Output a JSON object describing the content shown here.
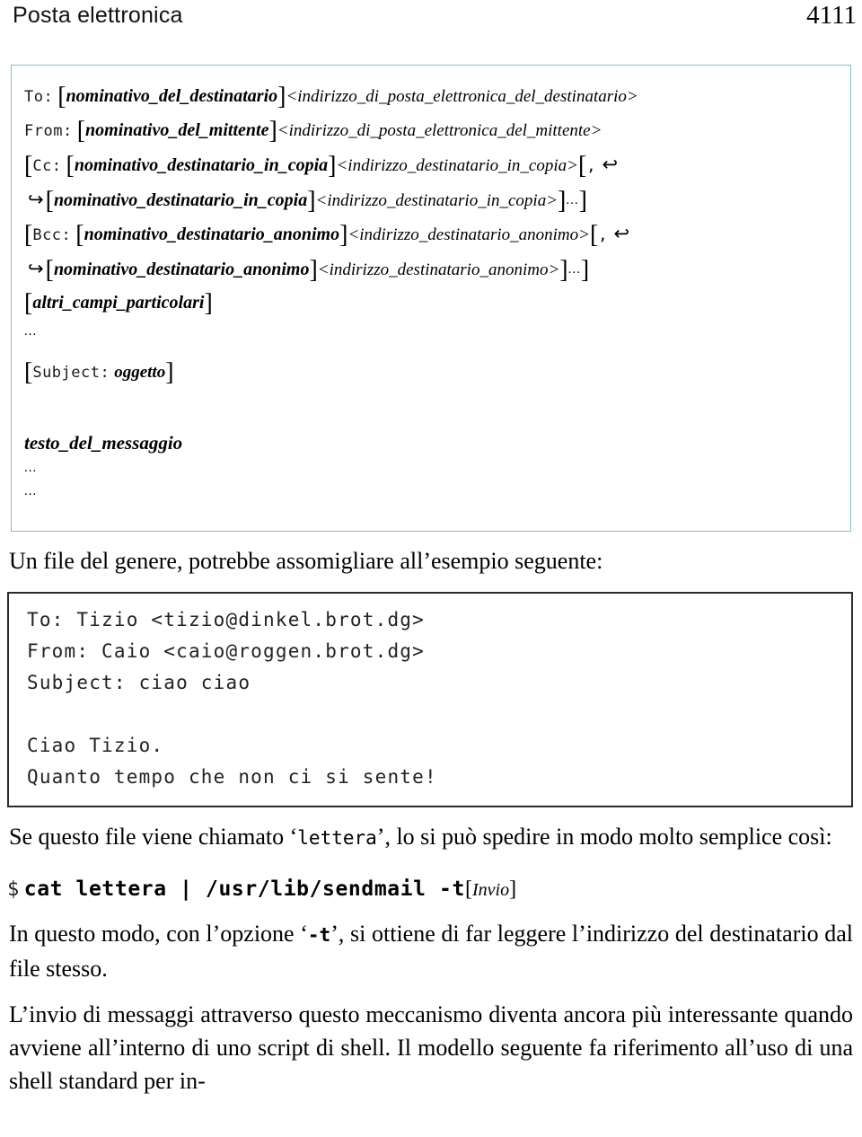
{
  "header": {
    "title": "Posta elettronica",
    "page_number": "4111"
  },
  "syntax_box": {
    "to_label": "To:",
    "to_name": "nominativo_del_destinatario",
    "to_addr": "<indirizzo_di_posta_elettronica_del_destinatario>",
    "from_label": "From:",
    "from_name": "nominativo_del_mittente",
    "from_addr": "<indirizzo_di_posta_elettronica_del_mittente>",
    "cc_label": "Cc:",
    "cc_name": "nominativo_destinatario_in_copia",
    "cc_addr": "<indirizzo_destinatario_in_copia>",
    "cc_name2": "nominativo_destinatario_in_copia",
    "cc_addr2": "<indirizzo_destinatario_in_copia>",
    "bcc_label": "Bcc:",
    "bcc_name": "nominativo_destinatario_anonimo",
    "bcc_addr": "<indirizzo_destinatario_anonimo>",
    "bcc_name2": "nominativo_destinatario_anonimo",
    "bcc_addr2": "<indirizzo_destinatario_anonimo>",
    "other_fields": "altri_campi_particolari",
    "subject_label": "Subject:",
    "subject_value": "oggetto",
    "body_placeholder": "testo_del_messaggio",
    "ellipsis": "...",
    "comma": ",",
    "bracket_open": "[",
    "bracket_close": "]",
    "arrow_end": "↩",
    "arrow_start": "↪",
    "border_color": "#7fbdd2"
  },
  "paragraphs": {
    "intro": {
      "text": "Un file del genere, potrebbe assomigliare all’esempio seguente:"
    },
    "after_example_a": "Se questo file viene chiamato ‘",
    "after_example_code": "lettera",
    "after_example_b": "’, lo si può spedire in modo molto semplice così:",
    "after_cmd_a": "In questo modo, con l’opzione ‘",
    "after_cmd_code": "-t",
    "after_cmd_b": "’, si ottiene di far leggere l’indirizzo del destinatario dal file stesso.",
    "closing": "L’invio di messaggi attraverso questo meccanismo diventa ancora più interessante quando avviene all’interno di uno script di shell. Il modello seguente fa riferimento all’uso di una shell standard per in-"
  },
  "example_box": {
    "lines": [
      "To: Tizio <tizio@dinkel.brot.dg>",
      "From: Caio <caio@roggen.brot.dg>",
      "Subject: ciao ciao",
      "",
      "Ciao Tizio.",
      "Quanto tempo che non ci si sente!"
    ],
    "border_color": "#2b2b2b"
  },
  "command": {
    "prompt": "$",
    "text": "cat lettera | /usr/lib/sendmail -t",
    "key_open": "[",
    "key_label": "Invio",
    "key_close": "]"
  }
}
